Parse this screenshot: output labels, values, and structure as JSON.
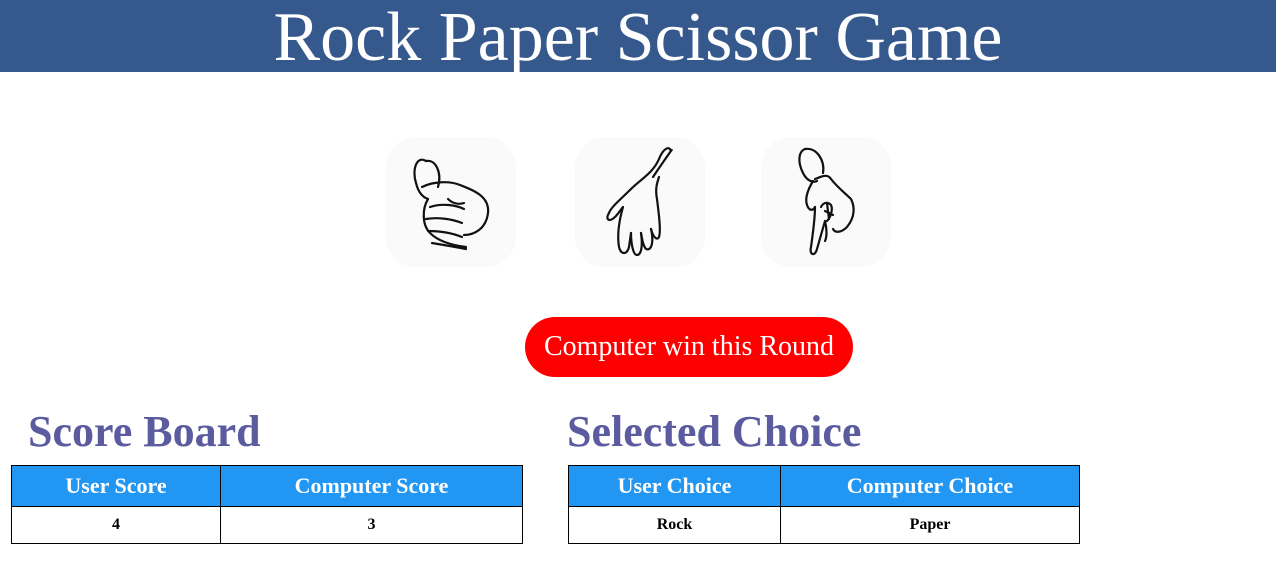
{
  "header": {
    "title": "Rock Paper Scissor Game"
  },
  "choices": [
    {
      "name": "rock",
      "icon": "fist-hand-icon"
    },
    {
      "name": "paper",
      "icon": "open-hand-icon"
    },
    {
      "name": "scissor",
      "icon": "two-finger-hand-icon"
    }
  ],
  "result": {
    "message": "Computer win this Round",
    "color": "#ff0000"
  },
  "score_board": {
    "title": "Score Board",
    "headers": [
      "User Score",
      "Computer Score"
    ],
    "values": [
      "4",
      "3"
    ]
  },
  "selected_choice": {
    "title": "Selected Choice",
    "headers": [
      "User Choice",
      "Computer Choice"
    ],
    "values": [
      "Rock",
      "Paper"
    ]
  },
  "colors": {
    "header_bg": "#35588d",
    "table_header_bg": "#2196f3",
    "section_title": "#5b5b9f"
  }
}
